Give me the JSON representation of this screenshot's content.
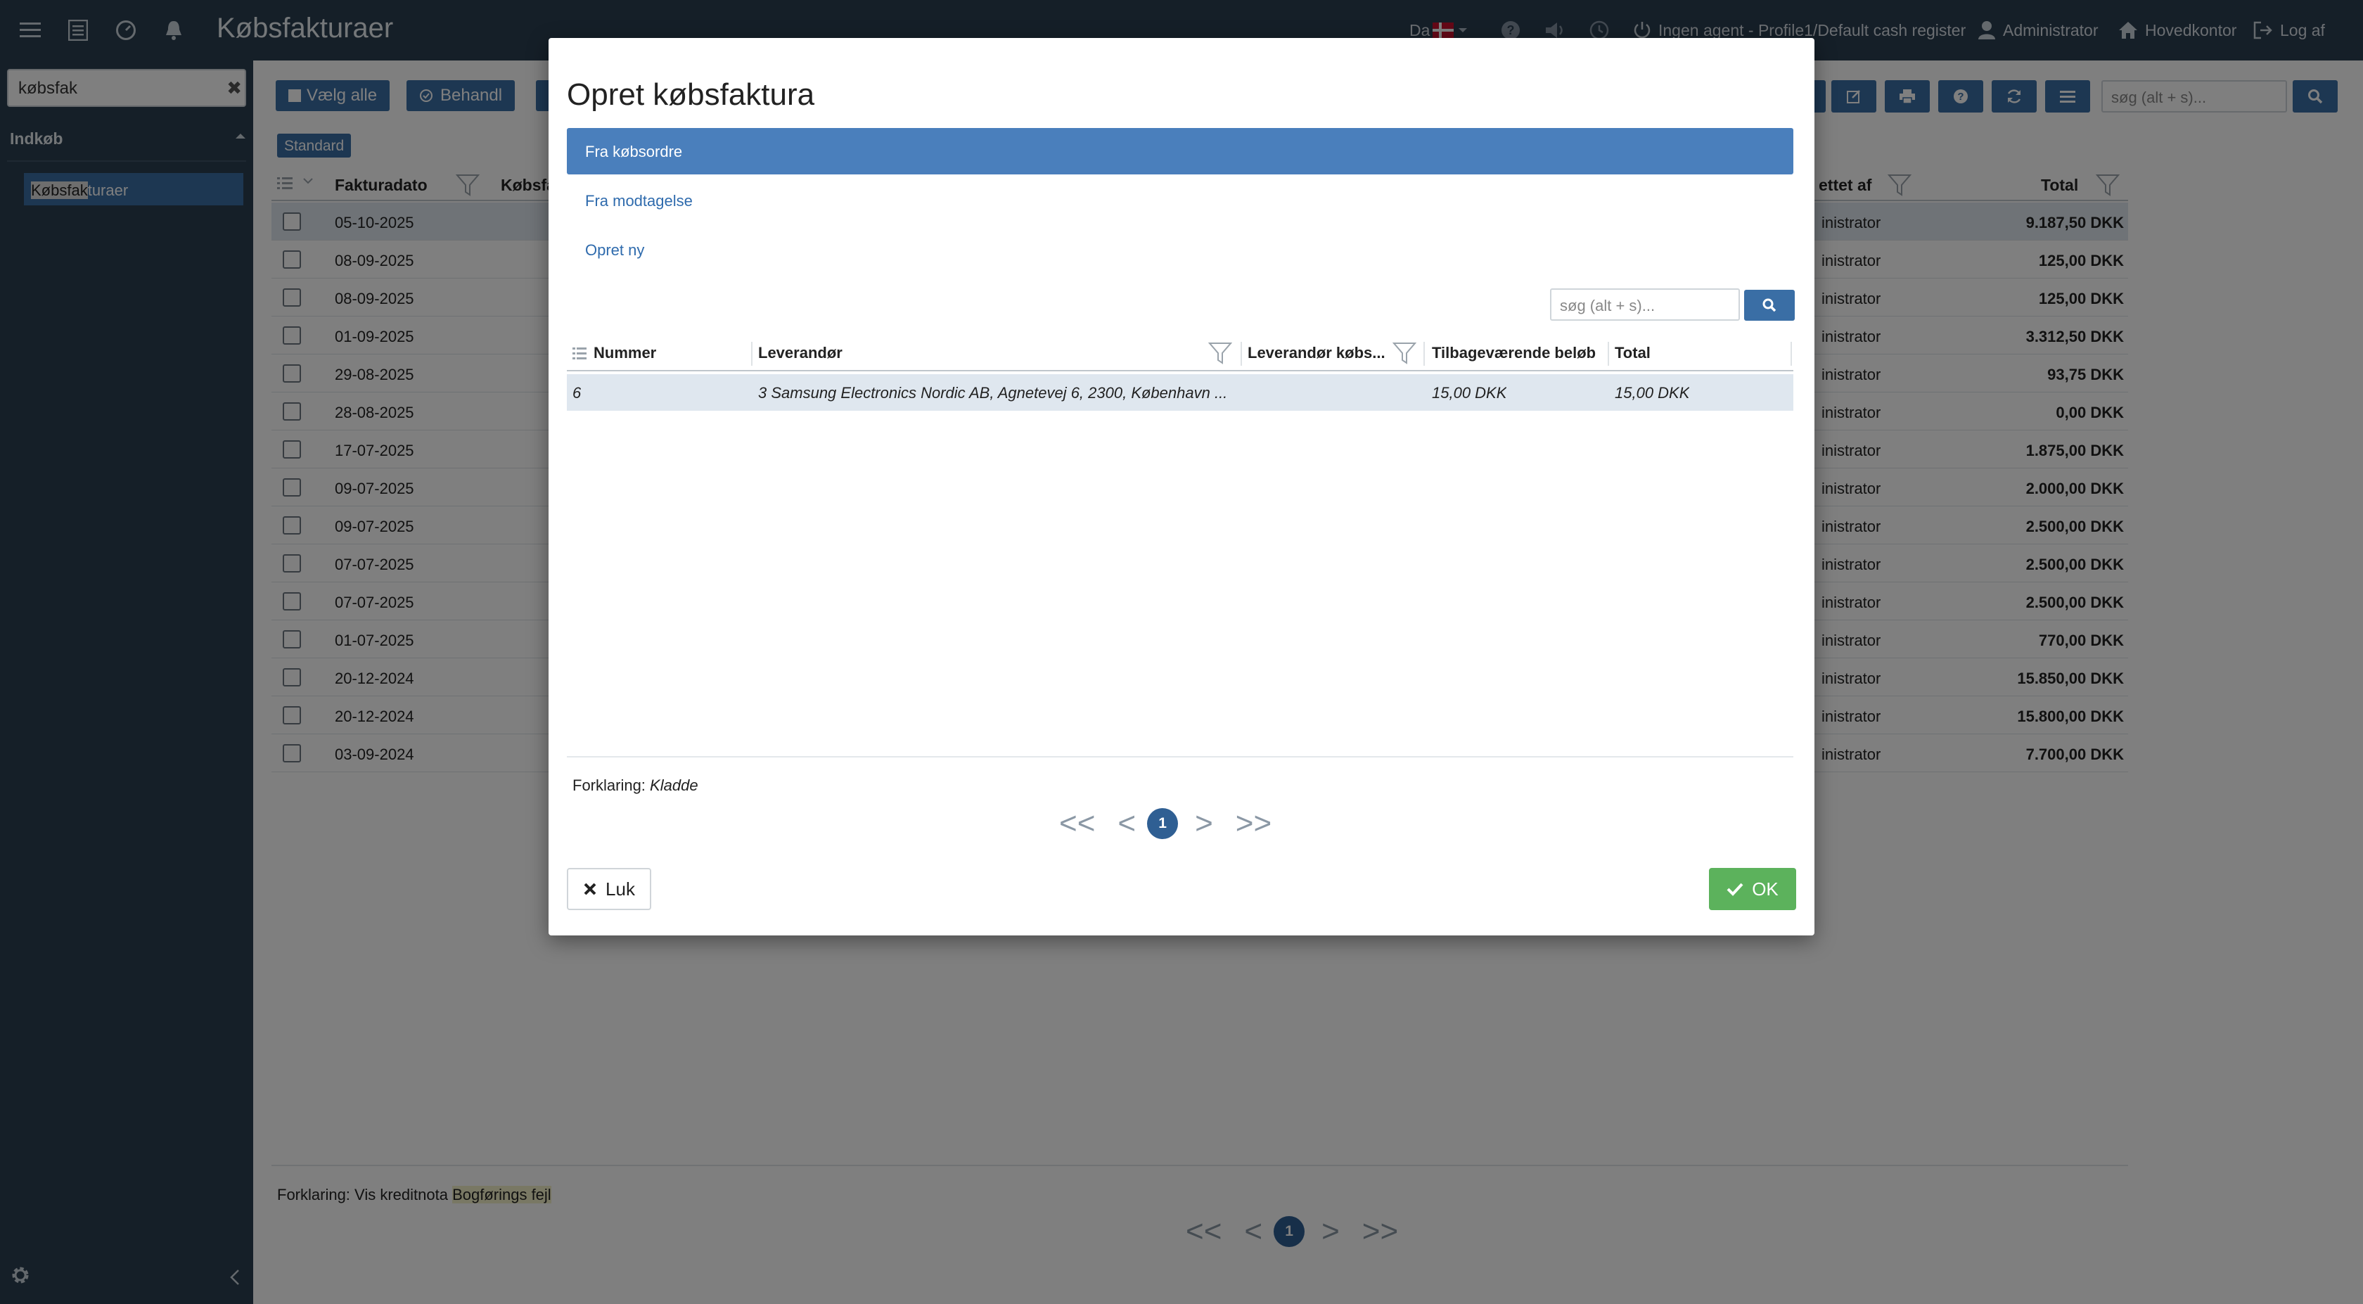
{
  "header": {
    "app_title": "Købsfakturaer",
    "language": "Da",
    "agent_status": "Ingen agent - Profile1/Default cash register",
    "user": "Administrator",
    "office": "Hovedkontor",
    "logout": "Log af"
  },
  "sidebar": {
    "search_value": "købsfak",
    "section": "Indkøb",
    "item_highlight": "Købsfak",
    "item_rest": "turaer"
  },
  "toolbar": {
    "select_all": "Vælg alle",
    "process": "Behandl",
    "search_placeholder": "søg (alt + s)..."
  },
  "view_tag": "Standard",
  "table": {
    "headers": {
      "date": "Fakturadato",
      "number": "Købsfa",
      "created_by": "ettet af",
      "total": "Total"
    },
    "rows": [
      {
        "date": "05-10-2025",
        "created_by": "inistrator",
        "total": "9.187,50 DKK"
      },
      {
        "date": "08-09-2025",
        "created_by": "inistrator",
        "total": "125,00 DKK"
      },
      {
        "date": "08-09-2025",
        "created_by": "inistrator",
        "total": "125,00 DKK"
      },
      {
        "date": "01-09-2025",
        "created_by": "inistrator",
        "total": "3.312,50 DKK"
      },
      {
        "date": "29-08-2025",
        "created_by": "inistrator",
        "total": "93,75 DKK"
      },
      {
        "date": "28-08-2025",
        "created_by": "inistrator",
        "total": "0,00 DKK"
      },
      {
        "date": "17-07-2025",
        "created_by": "inistrator",
        "total": "1.875,00 DKK"
      },
      {
        "date": "09-07-2025",
        "created_by": "inistrator",
        "total": "2.000,00 DKK"
      },
      {
        "date": "09-07-2025",
        "created_by": "inistrator",
        "total": "2.500,00 DKK"
      },
      {
        "date": "07-07-2025",
        "created_by": "inistrator",
        "total": "2.500,00 DKK"
      },
      {
        "date": "07-07-2025",
        "created_by": "inistrator",
        "total": "2.500,00 DKK"
      },
      {
        "date": "01-07-2025",
        "created_by": "inistrator",
        "total": "770,00 DKK"
      },
      {
        "date": "20-12-2024",
        "created_by": "inistrator",
        "total": "15.850,00 DKK"
      },
      {
        "date": "20-12-2024",
        "created_by": "inistrator",
        "total": "15.800,00 DKK"
      },
      {
        "date": "03-09-2024",
        "created_by": "inistrator",
        "total": "7.700,00 DKK"
      }
    ]
  },
  "footer": {
    "legend_label": "Forklaring:",
    "legend_credit": "Vis kreditnota",
    "legend_error": "Bogførings fejl",
    "pager_first": "<<",
    "pager_prev": "<",
    "pager_current": "1",
    "pager_next": ">",
    "pager_last": ">>"
  },
  "modal": {
    "title": "Opret købsfaktura",
    "options": [
      "Fra købsordre",
      "Fra modtagelse",
      "Opret ny"
    ],
    "search_placeholder": "søg (alt + s)...",
    "headers": [
      "Nummer",
      "Leverandør",
      "Leverandør købs...",
      "Tilbageværende beløb",
      "Total"
    ],
    "rows": [
      {
        "number": "6",
        "supplier": "3 Samsung Electronics Nordic AB, Agnetevej 6, 2300, København ...",
        "supplier_ref": "",
        "remaining": "15,00 DKK",
        "total": "15,00 DKK"
      }
    ],
    "legend_label": "Forklaring:",
    "legend_value": "Kladde",
    "pager_first": "<<",
    "pager_prev": "<",
    "pager_current": "1",
    "pager_next": ">",
    "pager_last": ">>",
    "close_label": "Luk",
    "ok_label": "OK"
  },
  "colors": {
    "header_bg": "#2b3e50",
    "accent": "#3a6ea5",
    "ok_green": "#5cb25c",
    "selected_row": "#dfe7ef"
  }
}
